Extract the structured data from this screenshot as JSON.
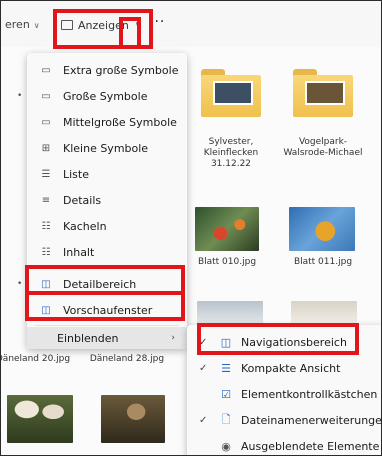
{
  "toolbar": {
    "sort_label": "eren",
    "view_label": "Anzeigen",
    "more_label": "···"
  },
  "view_menu": {
    "items": [
      {
        "label": "Extra große Symbole",
        "icon": "monitor-icon",
        "glyph": "▭",
        "bullet": false
      },
      {
        "label": "Große Symbole",
        "icon": "monitor-icon",
        "glyph": "▭",
        "bullet": true
      },
      {
        "label": "Mittelgroße Symbole",
        "icon": "monitor-small-icon",
        "glyph": "▭",
        "bullet": false
      },
      {
        "label": "Kleine Symbole",
        "icon": "grid-icon",
        "glyph": "⊞",
        "bullet": false
      },
      {
        "label": "Liste",
        "icon": "list-icon",
        "glyph": "☰",
        "bullet": false
      },
      {
        "label": "Details",
        "icon": "details-icon",
        "glyph": "≡",
        "bullet": false
      },
      {
        "label": "Kacheln",
        "icon": "tiles-icon",
        "glyph": "☷",
        "bullet": false
      },
      {
        "label": "Inhalt",
        "icon": "content-icon",
        "glyph": "☷",
        "bullet": false
      },
      {
        "label": "Detailbereich",
        "icon": "details-pane-icon",
        "glyph": "◫",
        "bullet": true
      },
      {
        "label": "Vorschaufenster",
        "icon": "preview-pane-icon",
        "glyph": "◫",
        "bullet": false
      },
      {
        "label": "Einblenden",
        "icon": "",
        "glyph": "",
        "bullet": false,
        "arrow": "›"
      }
    ]
  },
  "show_submenu": {
    "items": [
      {
        "label": "Navigationsbereich",
        "icon": "navigation-pane-icon",
        "glyph": "◫",
        "checked": true
      },
      {
        "label": "Kompakte Ansicht",
        "icon": "compact-view-icon",
        "glyph": "☰",
        "checked": true
      },
      {
        "label": "Elementkontrollkästchen",
        "icon": "checkbox-icon",
        "glyph": "☑",
        "checked": false
      },
      {
        "label": "Dateinamenerweiterungen",
        "icon": "file-extension-icon",
        "glyph": "🗋",
        "checked": true
      },
      {
        "label": "Ausgeblendete Elemente",
        "icon": "hidden-items-icon",
        "glyph": "◉",
        "checked": false
      }
    ],
    "check_glyph": "✓"
  },
  "files": [
    {
      "name": "Sylvester, Kleinflecken 31.12.22",
      "kind": "folder"
    },
    {
      "name": "Vogelpark-Walsrode-Michael",
      "kind": "folder"
    },
    {
      "name": "Blatt 010.jpg",
      "kind": "image"
    },
    {
      "name": "Blatt 011.jpg",
      "kind": "image"
    },
    {
      "name": "Däneland 20.jpg",
      "kind": "image"
    },
    {
      "name": "Däneland 28.jpg",
      "kind": "image"
    }
  ],
  "colors": {
    "highlight": "#e0161b",
    "folder": "#f0c04c",
    "accent": "#2166c2"
  }
}
